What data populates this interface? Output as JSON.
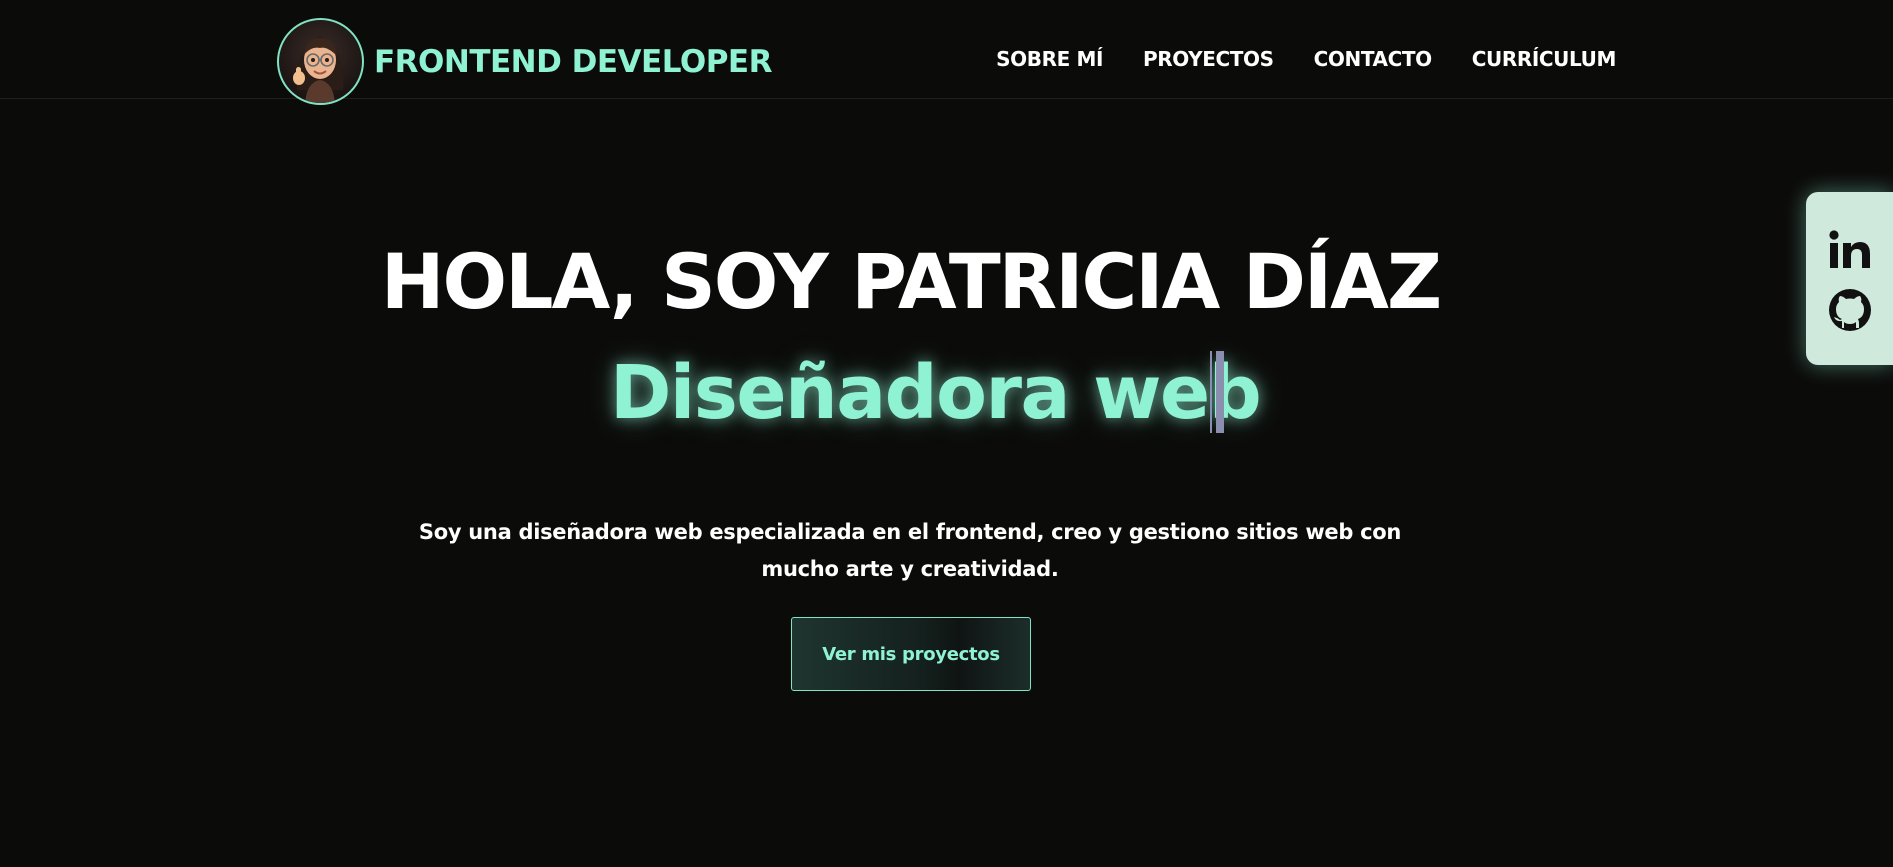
{
  "header": {
    "brand_title": "FRONTEND DEVELOPER",
    "nav": [
      {
        "label": "SOBRE MÍ"
      },
      {
        "label": "PROYECTOS"
      },
      {
        "label": "CONTACTO"
      },
      {
        "label": "CURRÍCULUM"
      }
    ]
  },
  "hero": {
    "title": "HOLA, SOY PATRICIA DÍAZ",
    "role": "Diseñadora web",
    "description": "Soy una diseñadora web especializada en el frontend, creo y gestiono sitios web con mucho arte y creatividad.",
    "cta_label": "Ver mis proyectos"
  },
  "social": {
    "icons": [
      "linkedin-icon",
      "github-icon"
    ]
  },
  "colors": {
    "background": "#0b0b0a",
    "accent": "#8ff2d2",
    "text": "#ffffff",
    "social_panel": "#cfe9dc"
  }
}
